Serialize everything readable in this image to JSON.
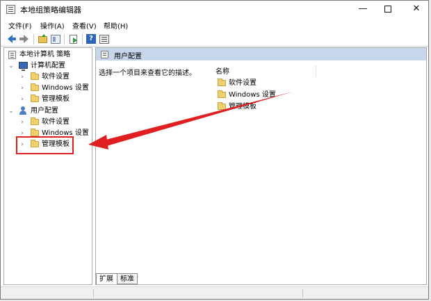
{
  "window": {
    "title": "本地组策略编辑器",
    "controls": {
      "minimize": "—",
      "close": "✕"
    }
  },
  "menu": [
    "文件(F)",
    "操作(A)",
    "查看(V)",
    "帮助(H)"
  ],
  "toolbar_icons": [
    "back-arrow-icon",
    "forward-arrow-icon",
    "folder-up-icon",
    "tree-view-icon",
    "export-icon",
    "help-icon",
    "properties-icon"
  ],
  "tree": {
    "root": "本地计算机 策略",
    "computer": {
      "label": "计算机配置",
      "children": [
        "软件设置",
        "Windows 设置",
        "管理模板"
      ]
    },
    "user": {
      "label": "用户配置",
      "children": [
        "软件设置",
        "Windows 设置",
        "管理模板"
      ]
    }
  },
  "right_pane": {
    "header": "用户配置",
    "description": "选择一个项目来查看它的描述。",
    "column_name": "名称",
    "items": [
      "软件设置",
      "Windows 设置",
      "管理模板"
    ]
  },
  "tabs": [
    "扩展",
    "标准"
  ],
  "background_fragment": "F",
  "colors": {
    "header_band": "#c7d6ea",
    "annotation_red": "#e02020",
    "folder": "#f0d06e"
  }
}
